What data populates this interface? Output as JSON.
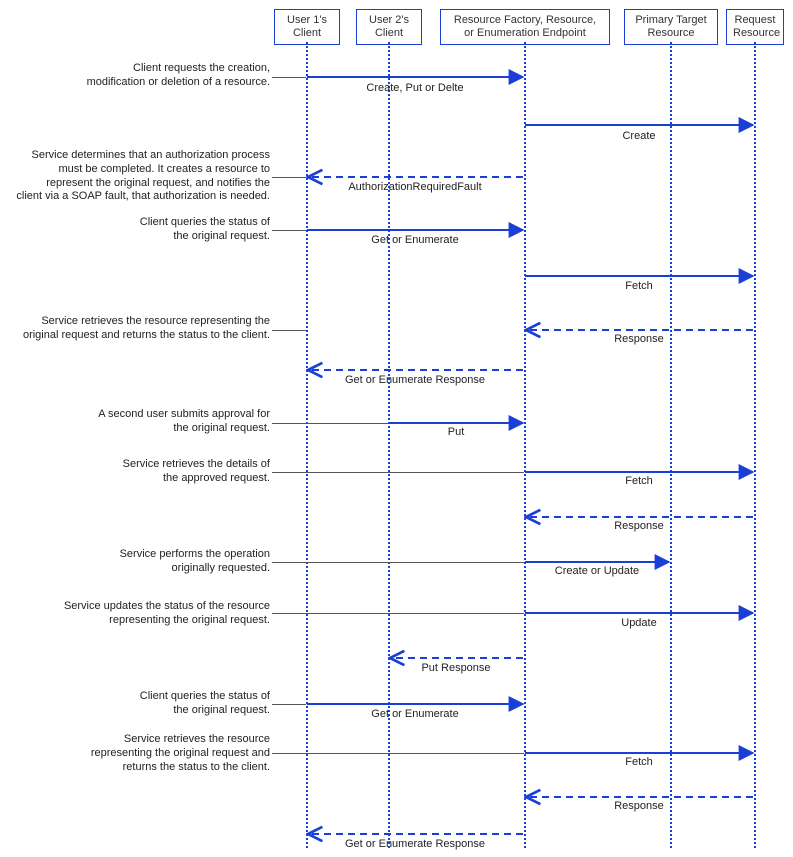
{
  "participants": {
    "p1": "User 1's\nClient",
    "p2": "User 2's\nClient",
    "p3": "Resource Factory, Resource,\nor Enumeration Endpoint",
    "p4": "Primary Target\nResource",
    "p5": "Request\nResource"
  },
  "descriptions": {
    "d1": "Client requests the creation,\nmodification or deletion of a resource.",
    "d2": "Service determines that an authorization process\nmust be completed. It creates a resource to\nrepresent the original request, and notifies the\nclient via a SOAP fault, that authorization is needed.",
    "d3": "Client queries the status of\nthe original request.",
    "d4": "Service retrieves the resource representing the\noriginal request and returns the status to the client.",
    "d5": "A second user submits approval for\nthe original request.",
    "d6": "Service retrieves the details of\nthe approved  request.",
    "d7": "Service performs the operation\noriginally requested.",
    "d8": "Service updates the status of the resource\nrepresenting the original request.",
    "d9": "Client queries the status of\nthe original request.",
    "d10": "Service retrieves the resource\nrepresenting the original request and\nreturns the status to the client."
  },
  "messages": {
    "m1": "Create, Put or Delte",
    "m2": "Create",
    "m3": "AuthorizationRequiredFault",
    "m4": "Get or Enumerate",
    "m5": "Fetch",
    "m6": "Response",
    "m7": "Get or Enumerate Response",
    "m8": "Put",
    "m9": "Fetch",
    "m10": "Response",
    "m11": "Create or Update",
    "m12": "Update",
    "m13": "Put Response",
    "m14": "Get or Enumerate",
    "m15": "Fetch",
    "m16": "Response",
    "m17": "Get or Enumerate Response"
  },
  "colors": {
    "blue": "#1a3fd6"
  }
}
